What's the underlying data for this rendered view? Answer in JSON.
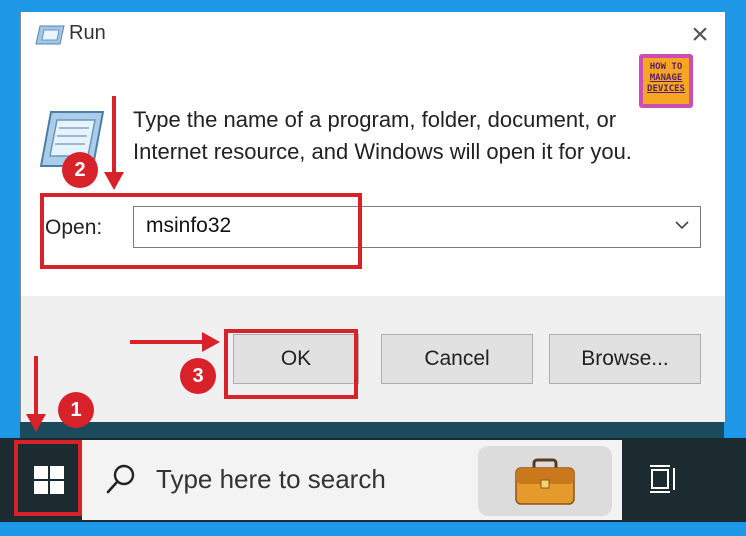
{
  "window": {
    "title": "Run",
    "description": "Type the name of a program, folder, document, or Internet resource, and Windows will open it for you.",
    "open_label": "Open:",
    "open_value": "msinfo32",
    "buttons": {
      "ok": "OK",
      "cancel": "Cancel",
      "browse": "Browse..."
    }
  },
  "logo": {
    "line1": "HOW TO",
    "line2": "MANAGE",
    "line3": "DEVICES"
  },
  "taskbar": {
    "search_placeholder": "Type here to search"
  },
  "annotations": {
    "step1": "1",
    "step2": "2",
    "step3": "3",
    "color": "#d8222a"
  },
  "colors": {
    "desktop": "#1e97e6",
    "taskbar": "#1c2b30",
    "button": "#e1e1e1"
  }
}
